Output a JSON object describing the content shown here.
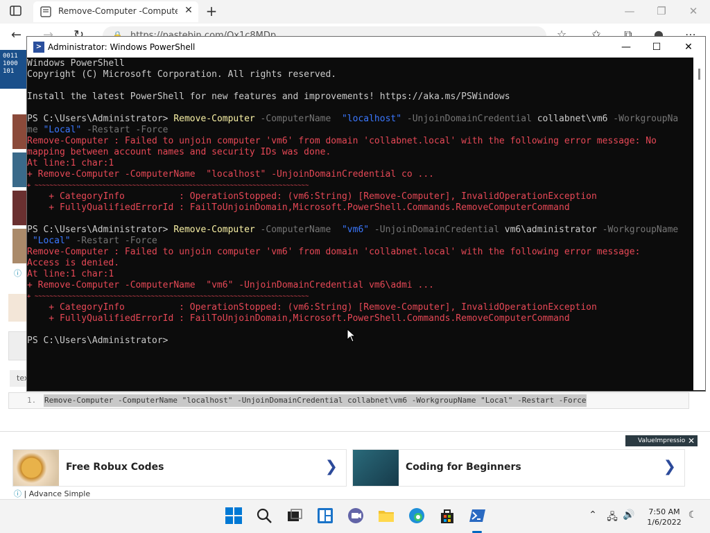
{
  "browser": {
    "tab_title": "Remove-Computer -ComputerN",
    "tab_close": "✕",
    "new_tab": "+",
    "address": "https://pastebin.com/Qx1c8MDp",
    "minimize": "—",
    "restore": "❐",
    "close": "✕"
  },
  "page": {
    "logo_text": "0011\n1000\n101",
    "code_label": "tex",
    "code_line_number": "1.",
    "code_line": "Remove-Computer -ComputerName  \"localhost\" -UnjoinDomainCredential collabnet\\vm6 -WorkgroupName \"Local\" -Restart -Force"
  },
  "ads": {
    "badge": "ValueImpression",
    "close": "✕",
    "cards": [
      {
        "title": "Free Robux Codes",
        "arrow": "❯"
      },
      {
        "title": "Coding for Beginners",
        "arrow": "❯"
      }
    ],
    "footer": "| Advance Simple"
  },
  "powershell": {
    "title": "Administrator: Windows PowerShell",
    "minimize": "—",
    "maximize": "☐",
    "close": "✕",
    "lines": {
      "l1": "Windows PowerShell",
      "l2": "Copyright (C) Microsoft Corporation. All rights reserved.",
      "l3": "Install the latest PowerShell for new features and improvements! https://aka.ms/PSWindows",
      "p1_prompt": "PS C:\\Users\\Administrator> ",
      "p1_cmd": "Remove-Computer",
      "p1_param1": " -ComputerName  ",
      "p1_val1": "\"localhost\"",
      "p1_param2": " -UnjoinDomainCredential ",
      "p1_val2": "collabnet\\vm6",
      "p1_param3": " -WorkgroupNa",
      "p1_wrap_param": "me ",
      "p1_wrap_val": "\"Local\"",
      "p1_wrap_rest": " -Restart -Force",
      "e1_a": "Remove-Computer : Failed to unjoin computer 'vm6' from domain 'collabnet.local' with the following error message: No",
      "e1_b": "mapping between account names and security IDs was done.",
      "e1_c": "At line:1 char:1",
      "e1_d": "+ Remove-Computer -ComputerName  \"localhost\" -UnjoinDomainCredential co ...",
      "e1_e": "+ ~~~~~~~~~~~~~~~~~~~~~~~~~~~~~~~~~~~~~~~~~~~~~~~~~~~~~~~~~~~~~~~~~~~~~~~~~",
      "e1_f": "    + CategoryInfo          : OperationStopped: (vm6:String) [Remove-Computer], InvalidOperationException",
      "e1_g": "    + FullyQualifiedErrorId : FailToUnjoinDomain,Microsoft.PowerShell.Commands.RemoveComputerCommand",
      "p2_prompt": "PS C:\\Users\\Administrator> ",
      "p2_cmd": "Remove-Computer",
      "p2_param1": " -ComputerName  ",
      "p2_val1": "\"vm6\"",
      "p2_param2": " -UnjoinDomainCredential ",
      "p2_val2": "vm6\\administrator",
      "p2_param3": " -WorkgroupName",
      "p2_wrap_val": " \"Local\"",
      "p2_wrap_rest": " -Restart -Force",
      "e2_a": "Remove-Computer : Failed to unjoin computer 'vm6' from domain 'collabnet.local' with the following error message:",
      "e2_b": "Access is denied.",
      "e2_c": "At line:1 char:1",
      "e2_d": "+ Remove-Computer -ComputerName  \"vm6\" -UnjoinDomainCredential vm6\\admi ...",
      "e2_e": "+ ~~~~~~~~~~~~~~~~~~~~~~~~~~~~~~~~~~~~~~~~~~~~~~~~~~~~~~~~~~~~~~~~~~~~~~~~~",
      "e2_f": "    + CategoryInfo          : OperationStopped: (vm6:String) [Remove-Computer], InvalidOperationException",
      "e2_g": "    + FullyQualifiedErrorId : FailToUnjoinDomain,Microsoft.PowerShell.Commands.RemoveComputerCommand",
      "p3_prompt": "PS C:\\Users\\Administrator>"
    }
  },
  "taskbar": {
    "time": "7:50 AM",
    "date": "1/6/2022",
    "tray_chevron": "⌃"
  },
  "colors": {
    "console_bg": "#0c0c0c",
    "error_red": "#e74856",
    "command_yellow": "#f9f1a5",
    "string_blue": "#3b78ff",
    "param_gray": "#767676"
  }
}
